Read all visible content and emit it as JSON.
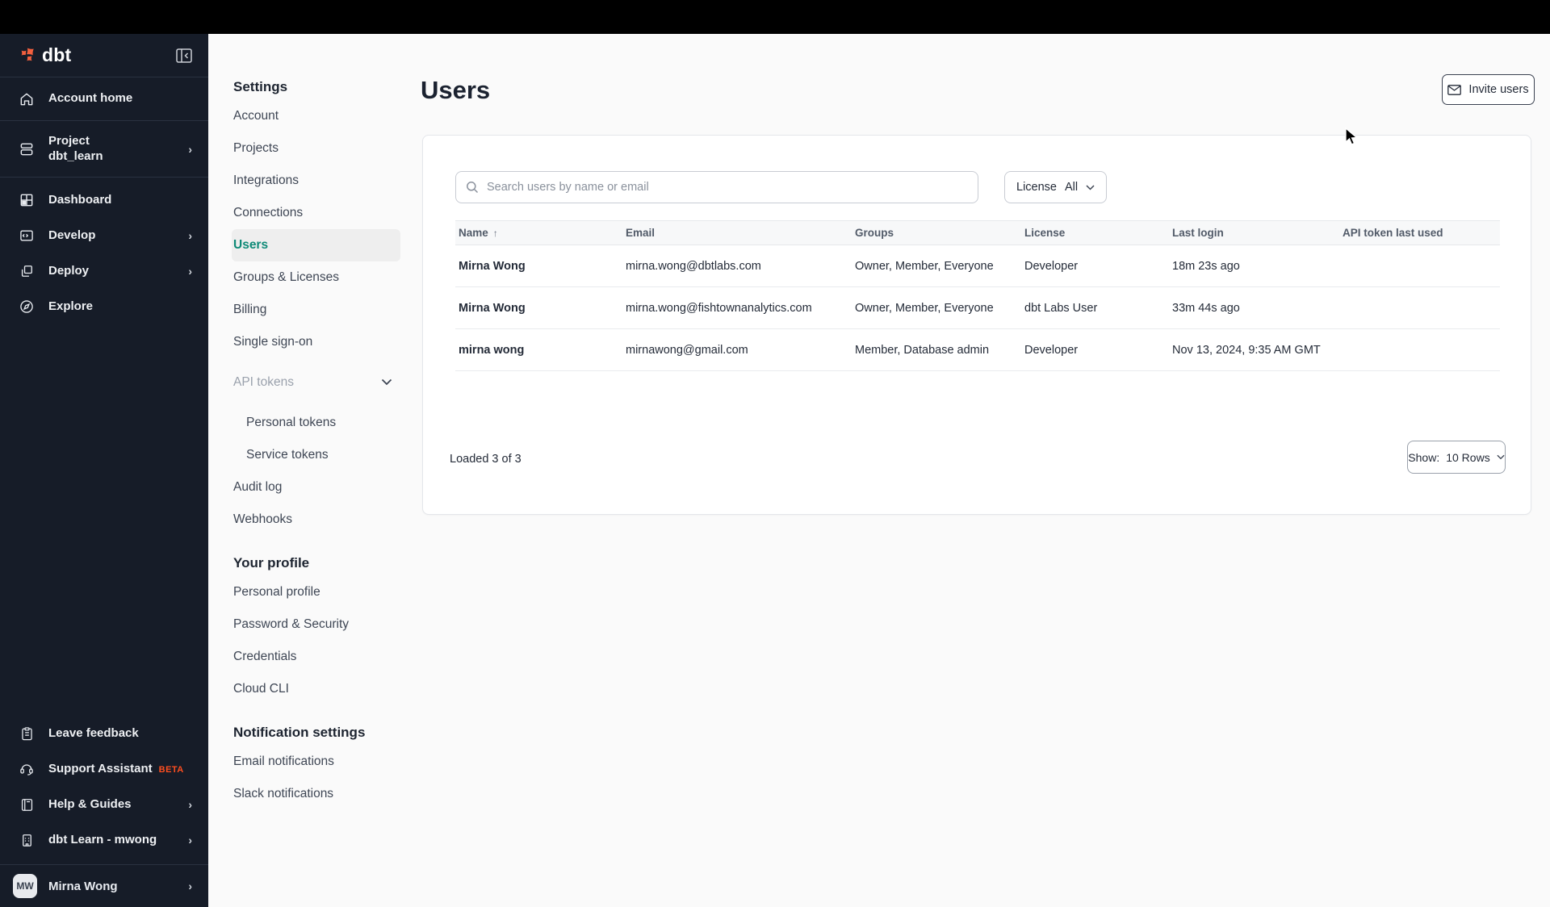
{
  "sidebar": {
    "logo_text": "dbt",
    "items": [
      {
        "label": "Account home",
        "icon": "home-icon",
        "chevron": false
      },
      {
        "label": "Project",
        "sublabel": "dbt_learn",
        "icon": "project-stack-icon",
        "chevron": true
      },
      {
        "label": "Dashboard",
        "icon": "dashboard-grid-icon",
        "chevron": false
      },
      {
        "label": "Develop",
        "icon": "develop-code-icon",
        "chevron": true
      },
      {
        "label": "Deploy",
        "icon": "deploy-icon",
        "chevron": true
      },
      {
        "label": "Explore",
        "icon": "explore-compass-icon",
        "chevron": false
      }
    ],
    "footer_items": [
      {
        "label": "Leave feedback",
        "icon": "clipboard-icon",
        "chevron": false,
        "badge": ""
      },
      {
        "label": "Support Assistant",
        "icon": "headset-icon",
        "chevron": false,
        "badge": "BETA"
      },
      {
        "label": "Help & Guides",
        "icon": "book-icon",
        "chevron": true,
        "badge": ""
      },
      {
        "label": "dbt Learn - mwong",
        "icon": "building-icon",
        "chevron": true,
        "badge": ""
      }
    ],
    "user": {
      "initials": "MW",
      "name": "Mirna Wong"
    }
  },
  "settings_nav": {
    "settings_heading": "Settings",
    "settings_items": {
      "account": "Account",
      "projects": "Projects",
      "integrations": "Integrations",
      "connections": "Connections",
      "users": "Users",
      "groups_licenses": "Groups & Licenses",
      "billing": "Billing",
      "single_sign_on": "Single sign-on",
      "api_tokens": "API tokens",
      "personal_tokens": "Personal tokens",
      "service_tokens": "Service tokens",
      "audit_log": "Audit log",
      "webhooks": "Webhooks"
    },
    "profile_heading": "Your profile",
    "profile_items": {
      "personal_profile": "Personal profile",
      "password_security": "Password & Security",
      "credentials": "Credentials",
      "cloud_cli": "Cloud CLI"
    },
    "notification_heading": "Notification settings",
    "notification_items": {
      "email_notifications": "Email notifications",
      "slack_notifications": "Slack notifications"
    }
  },
  "main": {
    "title": "Users",
    "invite_button_label": "Invite users",
    "search_placeholder": "Search users by name or email",
    "license_filter": {
      "label": "License",
      "value": "All"
    },
    "table": {
      "columns": {
        "name": "Name",
        "email": "Email",
        "groups": "Groups",
        "license": "License",
        "last_login": "Last login",
        "api_token_last_used": "API token last used"
      },
      "sort_indicator": "↑",
      "rows": [
        {
          "name": "Mirna Wong",
          "email": "mirna.wong@dbtlabs.com",
          "groups": "Owner, Member, Everyone",
          "license": "Developer",
          "last_login": "18m 23s ago",
          "api_token_last_used": ""
        },
        {
          "name": "Mirna Wong",
          "email": "mirna.wong@fishtownanalytics.com",
          "groups": "Owner, Member, Everyone",
          "license": "dbt Labs User",
          "last_login": "33m 44s ago",
          "api_token_last_used": ""
        },
        {
          "name": "mirna wong",
          "email": "mirnawong@gmail.com",
          "groups": "Member, Database admin",
          "license": "Developer",
          "last_login": "Nov 13, 2024, 9:35 AM GMT",
          "api_token_last_used": ""
        }
      ]
    },
    "footer": {
      "loaded_text": "Loaded 3 of 3",
      "show_label": "Show:",
      "show_value": "10 Rows"
    }
  },
  "colors": {
    "sidebar_bg": "#161c28",
    "topbar_bg": "#000000",
    "brand_orange": "#ff4e1f",
    "selected_teal": "#0e8a77",
    "main_bg": "#fafafa",
    "card_bg": "#ffffff"
  }
}
